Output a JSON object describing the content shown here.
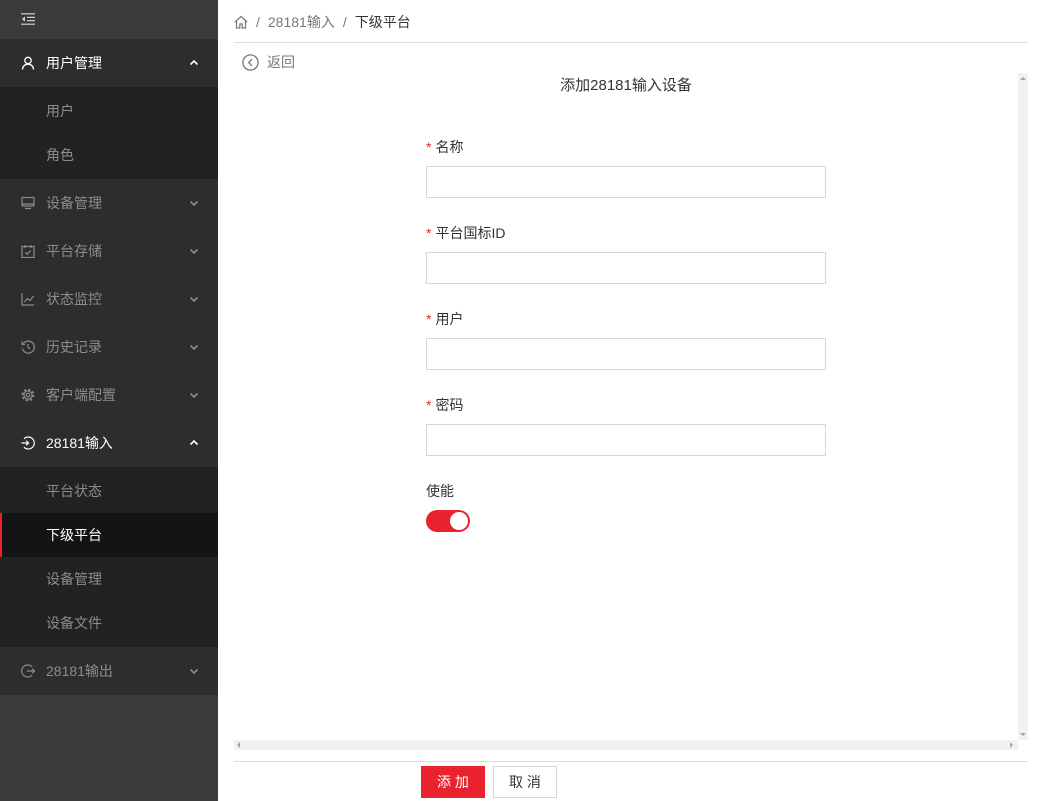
{
  "sidebar": {
    "collapse_icon": "menu-fold-icon",
    "menus": [
      {
        "label": "用户管理",
        "icon": "user-icon",
        "expanded": true,
        "children": [
          {
            "label": "用户"
          },
          {
            "label": "角色"
          }
        ]
      },
      {
        "label": "设备管理",
        "icon": "monitor-icon",
        "expanded": false
      },
      {
        "label": "平台存储",
        "icon": "calendar-check-icon",
        "expanded": false
      },
      {
        "label": "状态监控",
        "icon": "line-chart-icon",
        "expanded": false
      },
      {
        "label": "历史记录",
        "icon": "history-icon",
        "expanded": false
      },
      {
        "label": "客户端配置",
        "icon": "gear-icon",
        "expanded": false
      },
      {
        "label": "28181输入",
        "icon": "login-icon",
        "expanded": true,
        "children": [
          {
            "label": "平台状态"
          },
          {
            "label": "下级平台",
            "active": true
          },
          {
            "label": "设备管理"
          },
          {
            "label": "设备文件"
          }
        ]
      },
      {
        "label": "28181输出",
        "icon": "logout-icon",
        "expanded": false
      }
    ]
  },
  "breadcrumb": {
    "home_icon": "home-icon",
    "separator": "/",
    "items": [
      "28181输入",
      "下级平台"
    ]
  },
  "back": {
    "icon": "back-circle-icon",
    "label": "返回"
  },
  "form": {
    "title": "添加28181输入设备",
    "required_mark": "*",
    "fields": [
      {
        "label": "名称",
        "required": true,
        "value": ""
      },
      {
        "label": "平台国标ID",
        "required": true,
        "value": ""
      },
      {
        "label": "用户",
        "required": true,
        "value": ""
      },
      {
        "label": "密码",
        "required": true,
        "value": ""
      }
    ],
    "enable": {
      "label": "使能",
      "checked": true
    }
  },
  "footer": {
    "submit_label": "添 加",
    "cancel_label": "取 消"
  },
  "colors": {
    "accent": "#e8232e",
    "sidebar_bg": "#3b3b3b",
    "menu_bg": "#2d2d2d",
    "submenu_bg": "#222222",
    "active_item_bg": "#141414"
  }
}
